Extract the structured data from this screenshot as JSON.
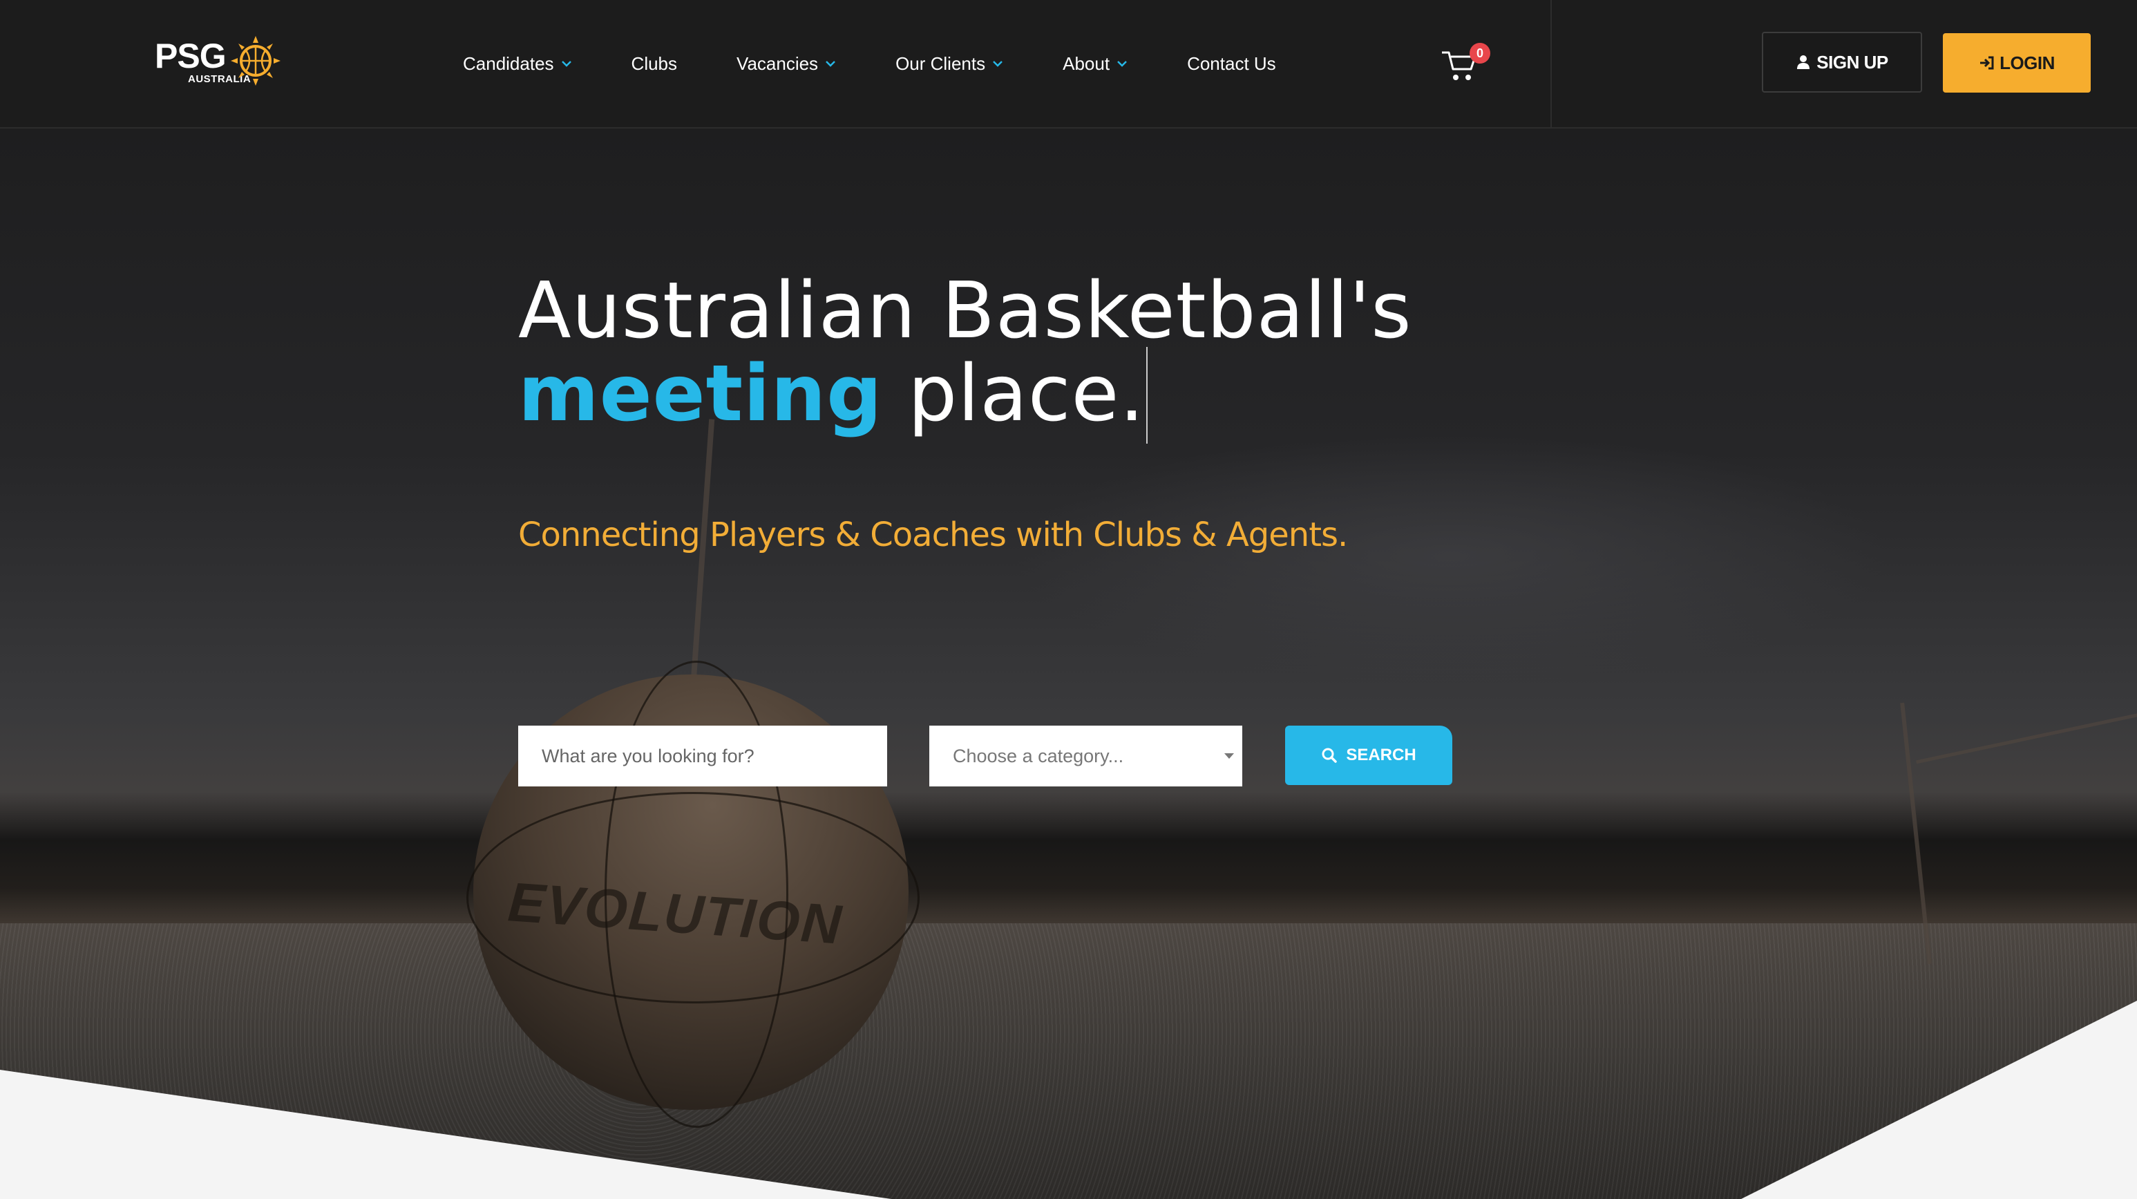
{
  "brand": {
    "name": "PSG",
    "sub": "AUSTRALIA"
  },
  "nav": {
    "items": [
      {
        "label": "Candidates",
        "dropdown": true
      },
      {
        "label": "Clubs",
        "dropdown": false
      },
      {
        "label": "Vacancies",
        "dropdown": true
      },
      {
        "label": "Our Clients",
        "dropdown": true
      },
      {
        "label": "About",
        "dropdown": true
      },
      {
        "label": "Contact Us",
        "dropdown": false
      }
    ],
    "cart_count": "0"
  },
  "auth": {
    "signup_label": "SIGN UP",
    "login_label": "LOGIN"
  },
  "hero": {
    "title_line1": "Australian Basketball's",
    "title_highlight": "meeting",
    "title_rest": " place.",
    "subtitle": "Connecting Players & Coaches with Clubs & Agents.",
    "ball_text": "EVOLUTION"
  },
  "search": {
    "placeholder": "What are you looking for?",
    "category_placeholder": "Choose a category...",
    "button_label": "SEARCH"
  },
  "colors": {
    "accent_blue": "#27b8e8",
    "accent_orange": "#f6ad2e",
    "subtitle_orange": "#f2ad37",
    "badge_red": "#e8464b",
    "header_bg": "#1c1c1c"
  },
  "icons": {
    "cart": "cart-icon",
    "user": "user-icon",
    "login": "sign-in-icon",
    "search": "search-icon",
    "chevron": "chevron-down-icon"
  }
}
